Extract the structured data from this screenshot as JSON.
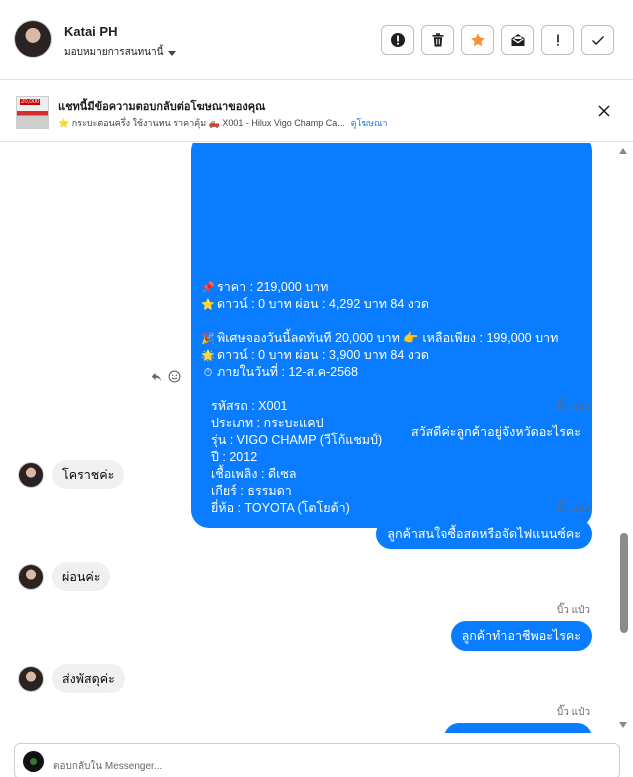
{
  "header": {
    "name": "Katai PH",
    "assign_label": "มอบหมายการสนทนานี้",
    "toolbar": [
      "alert-circle-icon",
      "trash-icon",
      "star-icon",
      "mark-unread-icon",
      "exclamation-icon",
      "check-icon"
    ],
    "star_color": "#f7923a"
  },
  "ad": {
    "thumb_text": "20,000",
    "title": "แชทนี้มีข้อความตอบกลับต่อโฆษณาของคุณ",
    "subtitle": "⭐ กระบะตอนครึ่ง ใช้งานทน ราคาคุ้ม 🛻 X001 - Hilux Vigo Champ Ca...",
    "link": "ดูโฆษณา"
  },
  "big_message": {
    "lines": [
      {
        "emoji": "📌",
        "text": "ราคา : 219,000 บาท"
      },
      {
        "emoji": "⭐",
        "text": "ดาวน์ : 0 บาท ผ่อน : 4,292 บาท 84 งวด"
      },
      {
        "emoji": "",
        "text": ""
      },
      {
        "emoji": "🎉",
        "text": "พิเศษจองวันนี้ลดทันที 20,000 บาท 👉 เหลือเพียง : 199,000 บาท"
      },
      {
        "emoji": "🌟",
        "text": "ดาวน์ : 0 บาท ผ่อน : 3,900 บาท 84 งวด"
      },
      {
        "emoji": "⏱",
        "text": "ภายในวันที่ : 12-ส.ค-2568"
      },
      {
        "emoji": "",
        "text": ""
      },
      {
        "emoji": "",
        "text": "รหัสรถ : X001"
      },
      {
        "emoji": "",
        "text": "ประเภท : กระบะแคป"
      },
      {
        "emoji": "",
        "text": "รุ่น : VIGO CHAMP (วีโก้แชมป์)"
      },
      {
        "emoji": "",
        "text": "ปี : 2012"
      },
      {
        "emoji": "",
        "text": "เชื้อเพลิง : ดีเซล"
      },
      {
        "emoji": "",
        "text": "เกียร์ : ธรรมดา"
      },
      {
        "emoji": "",
        "text": "ยี่ห้อ : TOYOTA (โตโยต้า)"
      }
    ]
  },
  "messages": [
    {
      "seen": "บิ๊ว แป๋ว",
      "out": "สวัสดีค่ะลูกค้าอยู่จังหวัดอะไรคะ",
      "in": "โคราชค่ะ"
    },
    {
      "seen": "บิ๊ว แป๋ว",
      "out": "ลูกค้าสนใจซื้อสดหรือจัดไฟแนนซ์คะ",
      "in": "ผ่อนค่ะ"
    },
    {
      "seen": "บิ๊ว แป๋ว",
      "out": "ลูกค้าทำอาชีพอะไรคะ",
      "in": "ส่งพัสดุค่ะ"
    },
    {
      "seen": "บิ๊ว แป๋ว"
    }
  ],
  "composer": {
    "placeholder": "ตอบกลับใน Messenger..."
  },
  "colors": {
    "bubble_blue": "#0a7cff",
    "incoming_gray": "#f0f0f0"
  }
}
